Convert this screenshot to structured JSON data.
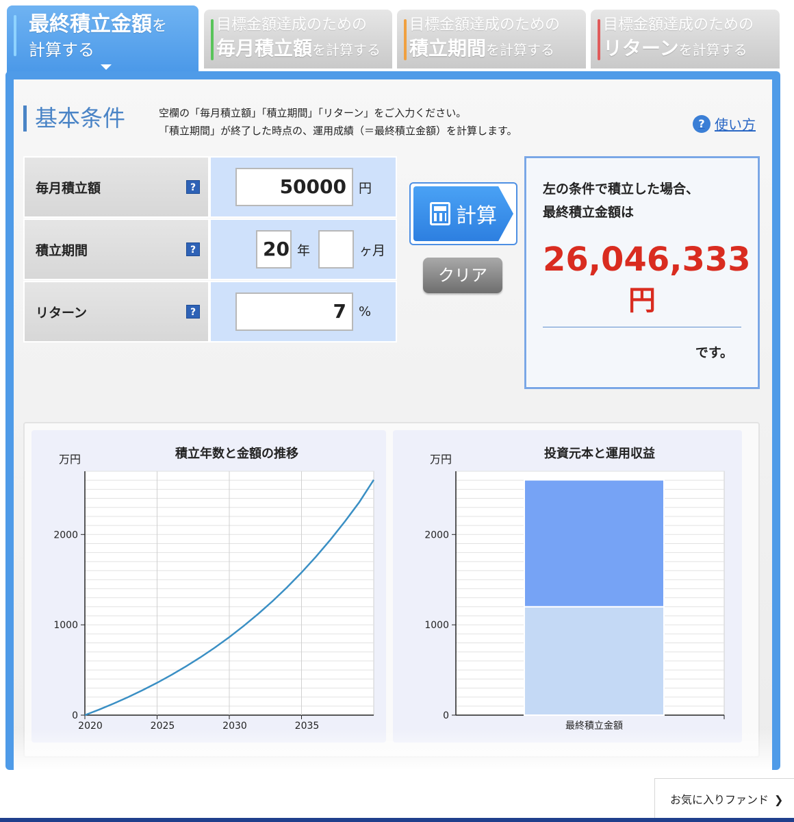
{
  "tabs": [
    {
      "line1": "最終積立金額",
      "line1_small": "を",
      "line2": "計算する",
      "line2_small": "",
      "color": "#4a98e8"
    },
    {
      "line1": "目標金額達成のための",
      "line2": "毎月積立額",
      "line2_small": "を計算する",
      "color": "#59c45a"
    },
    {
      "line1": "目標金額達成のための",
      "line2": "積立期間",
      "line2_small": "を計算する",
      "color": "#f0a040"
    },
    {
      "line1": "目標金額達成のための",
      "line2": "リターン",
      "line2_small": "を計算する",
      "color": "#e05a5a"
    }
  ],
  "section": {
    "title": "基本条件",
    "desc1": "空欄の「毎月積立額」「積立期間」「リターン」をご入力ください。",
    "desc2": "「積立期間」が終了した時点の、運用成績（＝最終積立金額）を計算します。",
    "howto": "使い方"
  },
  "form": {
    "monthly_label": "毎月積立額",
    "monthly_value": "50000",
    "monthly_unit": "円",
    "period_label": "積立期間",
    "period_years": "20",
    "period_years_unit": "年",
    "period_months": "",
    "period_months_unit": "ヶ月",
    "return_label": "リターン",
    "return_value": "7",
    "return_unit": "%",
    "help_icon": "?"
  },
  "buttons": {
    "calc": "計算",
    "clear": "クリア"
  },
  "result": {
    "line1": "左の条件で積立した場合、",
    "line2": "最終積立金額は",
    "amount": "26,046,333",
    "yen": "円",
    "desu": "です。"
  },
  "chart_data": [
    {
      "type": "line",
      "title": "積立年数と金額の推移",
      "ylabel": "万円",
      "x": [
        2020,
        2021,
        2022,
        2023,
        2024,
        2025,
        2026,
        2027,
        2028,
        2029,
        2030,
        2031,
        2032,
        2033,
        2034,
        2035,
        2036,
        2037,
        2038,
        2039,
        2040
      ],
      "series": [
        {
          "values": [
            0,
            62,
            129,
            200,
            277,
            358,
            446,
            540,
            640,
            748,
            864,
            988,
            1121,
            1263,
            1415,
            1579,
            1754,
            1942,
            2143,
            2358,
            2605
          ]
        }
      ],
      "xticks": [
        2020,
        2025,
        2030,
        2035
      ],
      "yticks": [
        0,
        1000,
        2000
      ],
      "ylim": [
        0,
        2700
      ],
      "grid": true,
      "color": "#3a8fc4"
    },
    {
      "type": "bar",
      "title": "投資元本と運用収益",
      "ylabel": "万円",
      "categories": [
        "最終積立金額"
      ],
      "series": [
        {
          "values": [
            1200
          ],
          "color": "#c4d9f5"
        },
        {
          "values": [
            1405
          ],
          "color": "#76a3f5"
        }
      ],
      "yticks": [
        0,
        1000,
        2000
      ],
      "ylim": [
        0,
        2700
      ],
      "stacked": true,
      "grid": true
    }
  ],
  "footer": {
    "favorite": "お気に入りファンド",
    "chevron": "❯"
  }
}
